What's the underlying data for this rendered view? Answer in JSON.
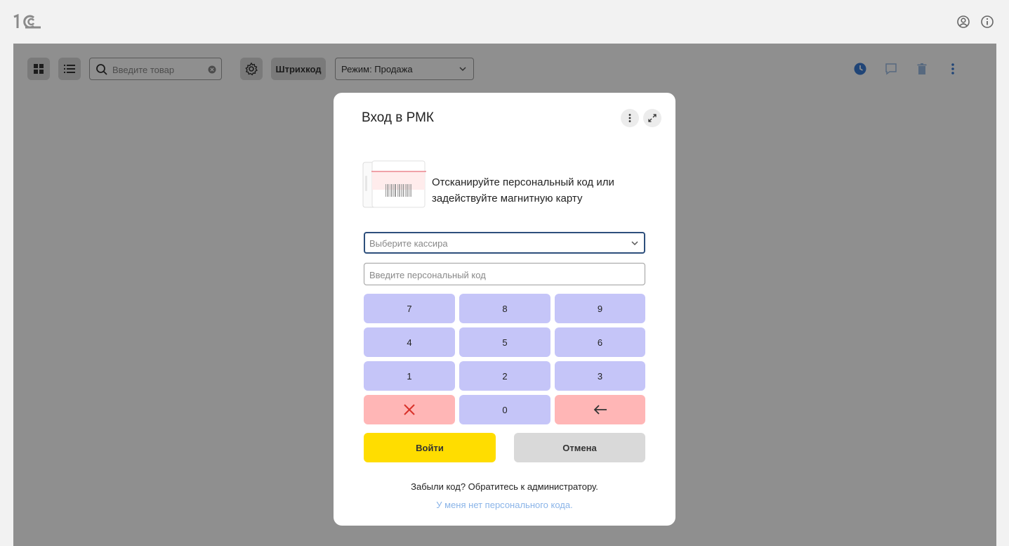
{
  "header": {
    "logo_text": "1C",
    "user_icon": "user-circle-icon",
    "info_icon": "info-circle-icon"
  },
  "toolbar": {
    "grid_icon": "grid-view-icon",
    "list_icon": "list-view-icon",
    "search_placeholder": "Введите товар",
    "settings_icon": "gear-icon",
    "barcode_label": "Штрихкод",
    "mode_label": "Режим: Продажа",
    "right_icons": [
      "clock-icon",
      "chat-icon",
      "trash-icon",
      "more-vertical-icon"
    ]
  },
  "modal": {
    "title": "Вход в РМК",
    "instruction": "Отсканируйте персональный код или задействуйте магнитную карту",
    "cashier_placeholder": "Выберите кассира",
    "code_placeholder": "Введите персональный код",
    "keys": [
      "7",
      "8",
      "9",
      "4",
      "5",
      "6",
      "1",
      "2",
      "3"
    ],
    "zero_key": "0",
    "clear_icon": "close-x-icon",
    "backspace_icon": "arrow-left-icon",
    "login_label": "Войти",
    "cancel_label": "Отмена",
    "forgot_text": "Забыли код? Обратитесь к администратору.",
    "no_code_link": "У меня нет персонального кода."
  },
  "colors": {
    "key_bg": "#c5c5f8",
    "key_red_bg": "#ffb6b6",
    "login_bg": "#ffdd00",
    "cancel_bg": "#d9d9d9",
    "link": "#8ab4e8",
    "accent_focus": "#2d4f7c"
  }
}
